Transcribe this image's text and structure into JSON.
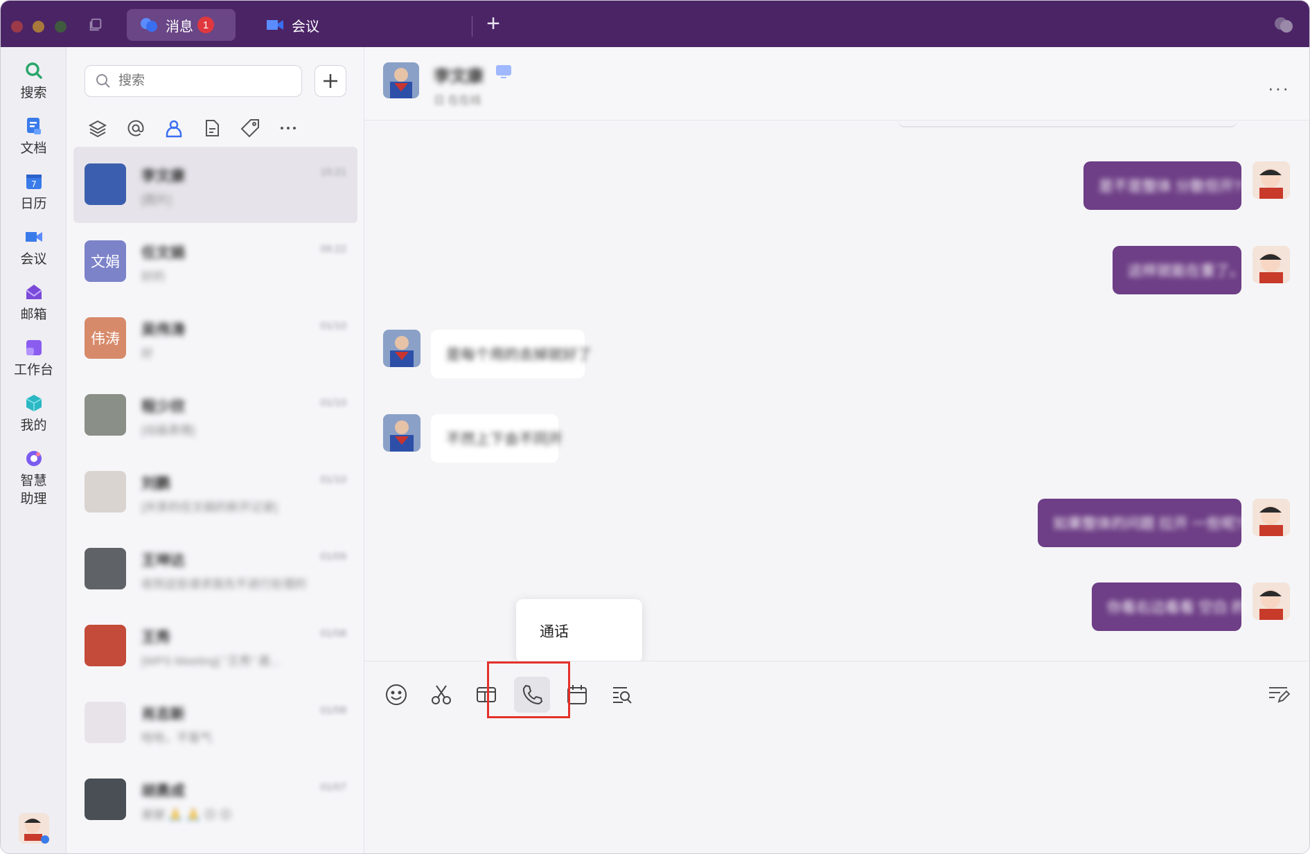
{
  "titlebar": {
    "tabs": [
      {
        "label": "消息",
        "badge": "1",
        "icon": "chat-bubbles-icon"
      },
      {
        "label": "会议",
        "icon": "video-camera-icon"
      }
    ],
    "new_tab": "+"
  },
  "rail": {
    "items": [
      {
        "label": "搜索",
        "icon": "search-icon",
        "color": "#2aa66b"
      },
      {
        "label": "文档",
        "icon": "document-icon",
        "color": "#3a7bea"
      },
      {
        "label": "日历",
        "icon": "calendar-icon",
        "color": "#3a7bea"
      },
      {
        "label": "会议",
        "icon": "video-camera-icon",
        "color": "#3a7bea"
      },
      {
        "label": "邮箱",
        "icon": "mail-icon",
        "color": "#7b4ad9"
      },
      {
        "label": "工作台",
        "icon": "workspace-icon",
        "color": "#8a5cf0"
      },
      {
        "label": "我的",
        "icon": "cube-icon",
        "color": "#2bb8c4"
      },
      {
        "label": "智慧\n助理",
        "icon": "assistant-icon",
        "color": "#7b5cf0"
      }
    ]
  },
  "list": {
    "search_placeholder": "搜索",
    "filters": [
      "layers-icon",
      "at-icon",
      "person-icon",
      "file-icon",
      "tag-icon",
      "more-icon"
    ],
    "conversations": [
      {
        "name": "李文康",
        "preview": "[图片]",
        "time": "15:21",
        "avatar_text": "",
        "avatar_color": "#3b5fae"
      },
      {
        "name": "任文娟",
        "preview": "好的",
        "time": "09:22",
        "avatar_text": "文娟",
        "avatar_color": "#7c83c9"
      },
      {
        "name": "吴伟涛",
        "preview": "好",
        "time": "01/10",
        "avatar_text": "伟涛",
        "avatar_color": "#d78a6a"
      },
      {
        "name": "程少欣",
        "preview": "[动画表情]",
        "time": "01/10",
        "avatar_text": "",
        "avatar_color": "#8a8f88"
      },
      {
        "name": "刘鹏",
        "preview": "[共享的任文娟的新开记录]",
        "time": "01/10",
        "avatar_text": "",
        "avatar_color": "#d9d4cf"
      },
      {
        "name": "王坤达",
        "preview": "收到这些请求我先不进行处理的可以...",
        "time": "01/09",
        "avatar_text": "",
        "avatar_color": "#5f6266"
      },
      {
        "name": "王秀",
        "preview": "[WPS Meeting] \"王秀\" 邀...",
        "time": "01/08",
        "avatar_text": "",
        "avatar_color": "#c44a3a"
      },
      {
        "name": "肖志新",
        "preview": "哈哈，不客气",
        "time": "01/08",
        "avatar_text": "",
        "avatar_color": "#e7e3e8"
      },
      {
        "name": "胡勇成",
        "preview": "谢谢 🙏 🙏 😊 😊",
        "time": "01/07",
        "avatar_text": "",
        "avatar_color": "#4a4f55"
      }
    ]
  },
  "chat": {
    "title": "李文康",
    "subtitle": "日 在在线",
    "messages": [
      {
        "dir": "out",
        "text": "是不是整体 分散但开?"
      },
      {
        "dir": "out",
        "text": "这样就能在重了。"
      },
      {
        "dir": "in",
        "text": "是每个用的去掉就好了"
      },
      {
        "dir": "in",
        "text": "不然上下会不同开"
      },
      {
        "dir": "out",
        "text": "如果整体的问题 拉开 一些呢?"
      },
      {
        "dir": "out",
        "text": "你看右边看看 空白 的"
      }
    ],
    "popup_label": "通话",
    "toolbar": [
      "emoji-icon",
      "scissors-icon",
      "screenshot-window-icon",
      "phone-icon",
      "calendar-icon",
      "search-history-icon"
    ],
    "format_icon": "text-format-icon"
  },
  "colors": {
    "titlebar": "#4b2466",
    "outgoing_bubble": "#6e3e86",
    "highlight": "#e4312b"
  }
}
